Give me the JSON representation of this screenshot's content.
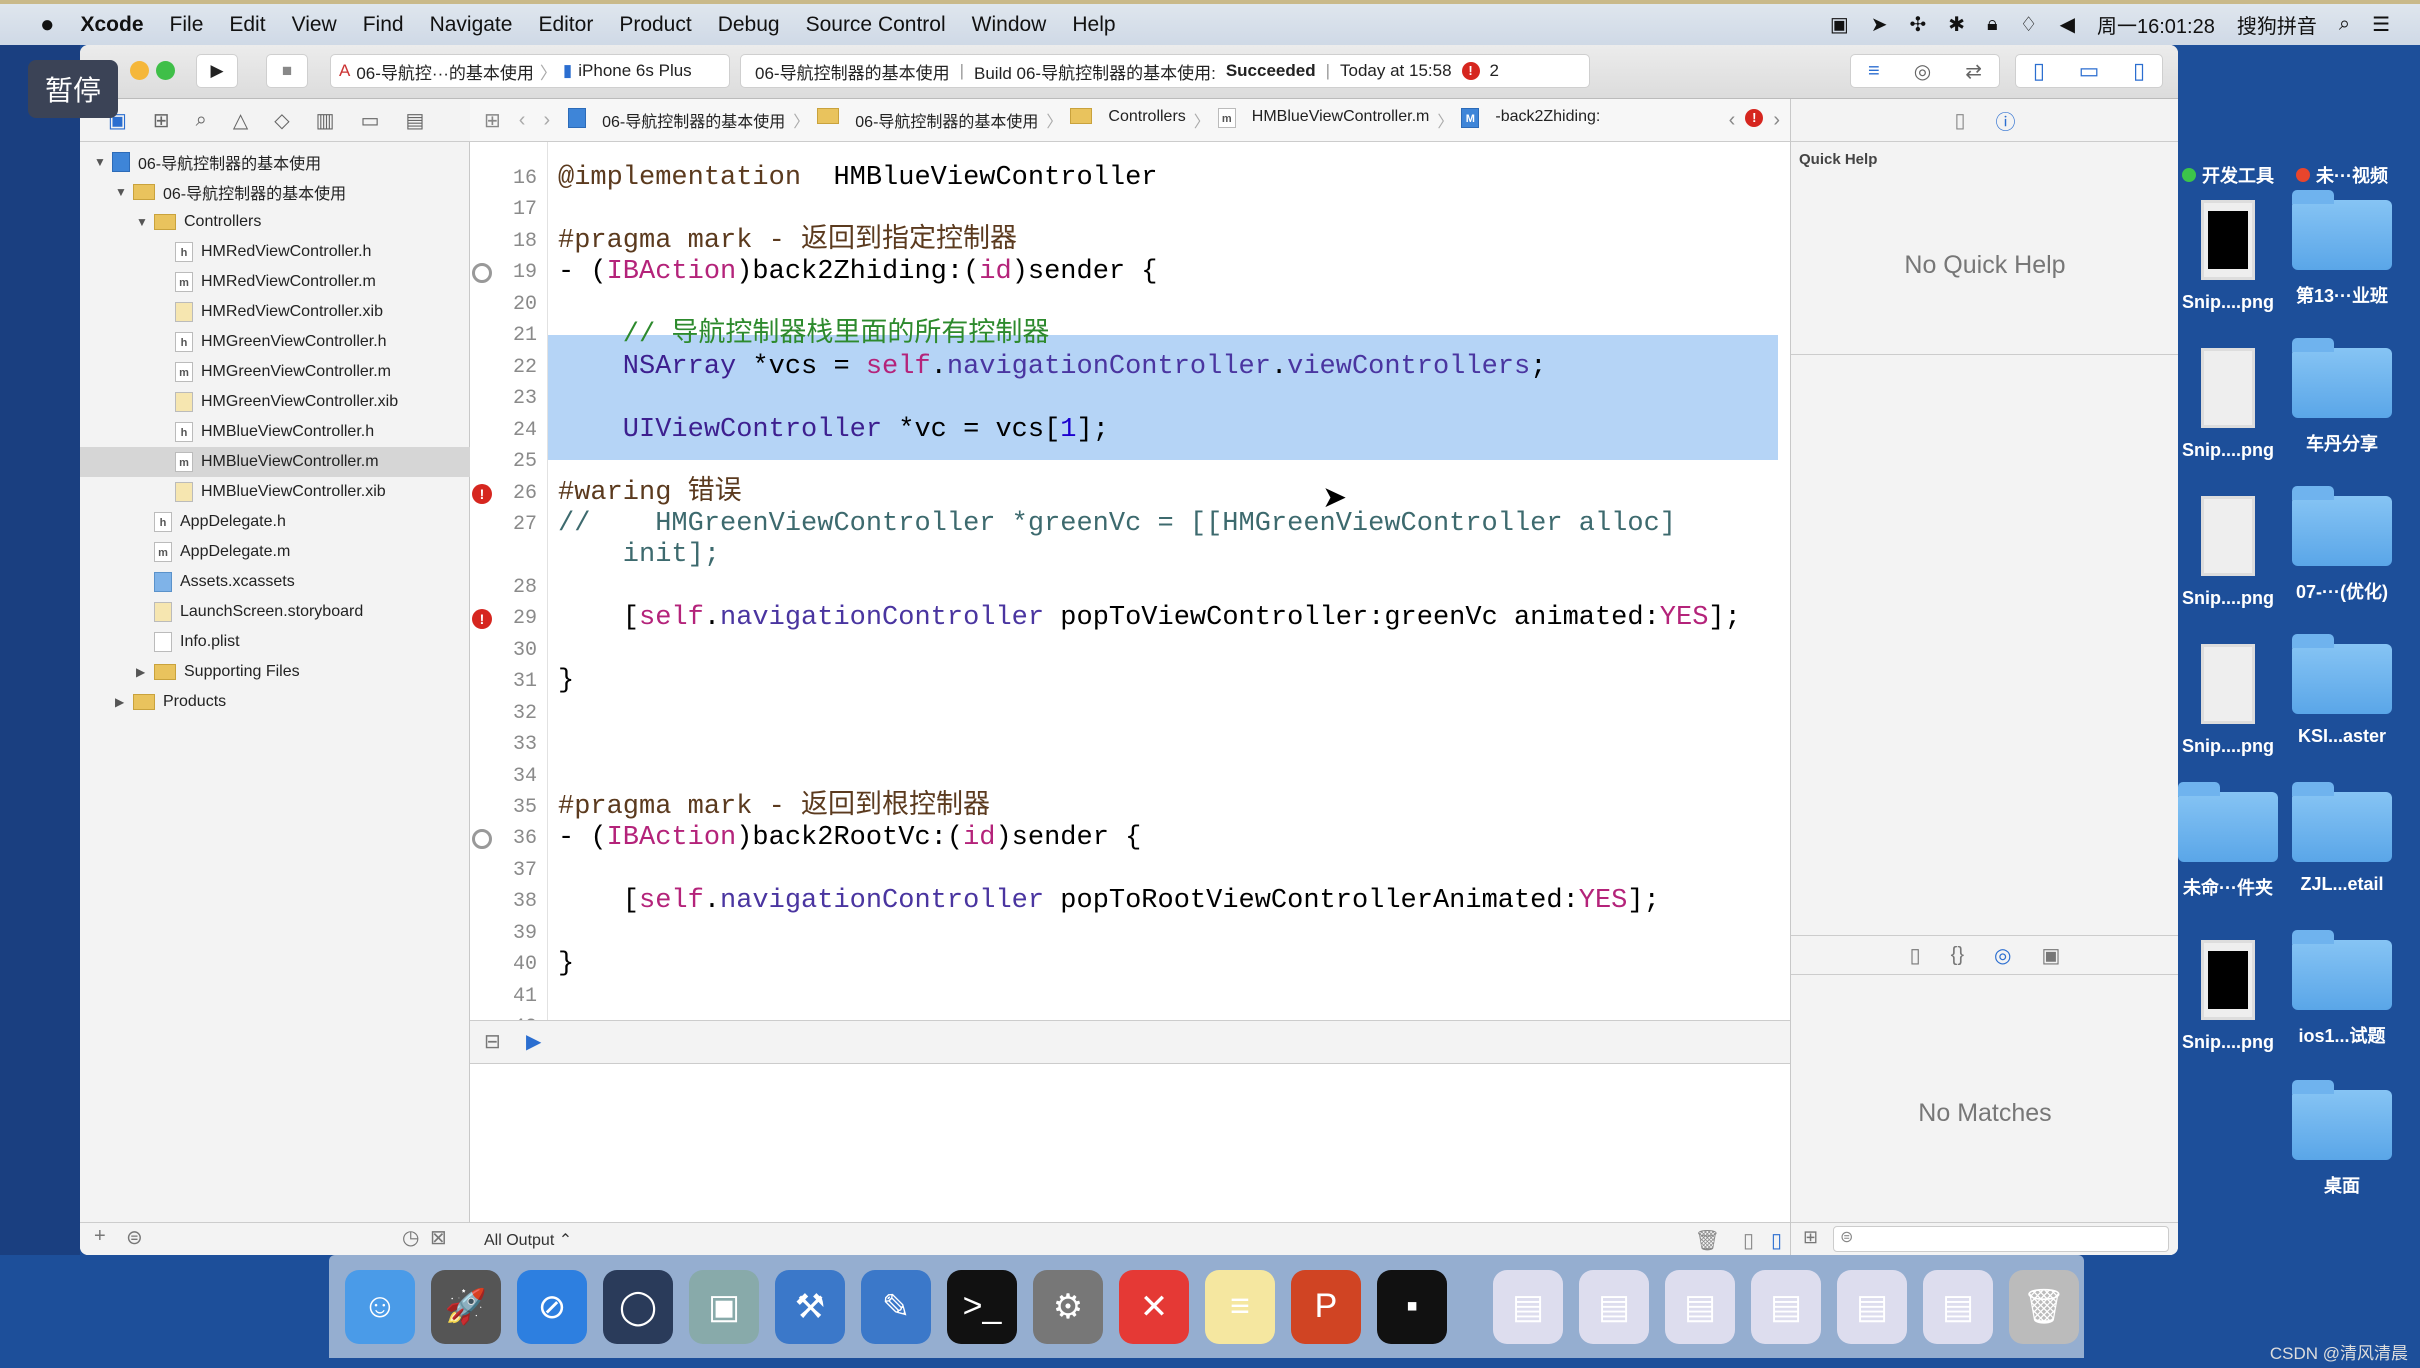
{
  "menubar": {
    "apple": "",
    "items": [
      "Xcode",
      "File",
      "Edit",
      "View",
      "Find",
      "Navigate",
      "Editor",
      "Product",
      "Debug",
      "Source Control",
      "Window",
      "Help"
    ],
    "clock": "周一16:01:28",
    "ime": "搜狗拼音"
  },
  "overlay": {
    "pause": "暂停"
  },
  "toolbar": {
    "scheme": "06-导航控···的基本使用",
    "device": "iPhone 6s Plus",
    "status_project": "06-导航控制器的基本使用",
    "status_build": "Build 06-导航控制器的基本使用:",
    "status_result": "Succeeded",
    "status_time": "Today at 15:58",
    "error_count": "2"
  },
  "navigator": {
    "rows": [
      {
        "label": "06-导航控制器的基本使用",
        "icon": "proj",
        "depth": 0,
        "tri": "▼"
      },
      {
        "label": "06-导航控制器的基本使用",
        "icon": "folder",
        "depth": 1,
        "tri": "▼"
      },
      {
        "label": "Controllers",
        "icon": "folder",
        "depth": 2,
        "tri": "▼"
      },
      {
        "label": "HMRedViewController.h",
        "icon": "h",
        "depth": 3
      },
      {
        "label": "HMRedViewController.m",
        "icon": "m",
        "depth": 3
      },
      {
        "label": "HMRedViewController.xib",
        "icon": "xib",
        "depth": 3
      },
      {
        "label": "HMGreenViewController.h",
        "icon": "h",
        "depth": 3
      },
      {
        "label": "HMGreenViewController.m",
        "icon": "m",
        "depth": 3
      },
      {
        "label": "HMGreenViewController.xib",
        "icon": "xib",
        "depth": 3
      },
      {
        "label": "HMBlueViewController.h",
        "icon": "h",
        "depth": 3
      },
      {
        "label": "HMBlueViewController.m",
        "icon": "m",
        "depth": 3,
        "selected": true
      },
      {
        "label": "HMBlueViewController.xib",
        "icon": "xib",
        "depth": 3
      },
      {
        "label": "AppDelegate.h",
        "icon": "h",
        "depth": 2
      },
      {
        "label": "AppDelegate.m",
        "icon": "m",
        "depth": 2
      },
      {
        "label": "Assets.xcassets",
        "icon": "assets",
        "depth": 2
      },
      {
        "label": "LaunchScreen.storyboard",
        "icon": "xib",
        "depth": 2
      },
      {
        "label": "Info.plist",
        "icon": "plist",
        "depth": 2
      },
      {
        "label": "Supporting Files",
        "icon": "folder",
        "depth": 2,
        "tri": "▶"
      },
      {
        "label": "Products",
        "icon": "folder",
        "depth": 1,
        "tri": "▶"
      }
    ]
  },
  "jumpbar": [
    "06-导航控制器的基本使用",
    "06-导航控制器的基本使用",
    "Controllers",
    "HMBlueViewController.m",
    "-back2Zhiding:"
  ],
  "editor": {
    "lines": [
      {
        "n": "16",
        "toks": [
          [
            "pr",
            "@implementation"
          ],
          [
            "",
            "  HMBlueViewController"
          ]
        ]
      },
      {
        "n": "17",
        "toks": []
      },
      {
        "n": "18",
        "toks": [
          [
            "pr",
            "#pragma mark - 返回到指定控制器"
          ]
        ]
      },
      {
        "n": "19",
        "marker": "bp",
        "toks": [
          [
            "",
            "- ("
          ],
          [
            "kw",
            "IBAction"
          ],
          [
            "",
            ")back2Zhiding:("
          ],
          [
            "kw",
            "id"
          ],
          [
            "",
            ")sender {"
          ]
        ]
      },
      {
        "n": "20",
        "toks": []
      },
      {
        "n": "21",
        "toks": [
          [
            "cm",
            "    // 导航控制器栈里面的所有控制器"
          ]
        ]
      },
      {
        "n": "22",
        "toks": [
          [
            "cls",
            "    NSArray"
          ],
          [
            "",
            " *vcs = "
          ],
          [
            "kw",
            "self"
          ],
          [
            "",
            "."
          ],
          [
            "me",
            "navigationController"
          ],
          [
            "",
            "."
          ],
          [
            "me",
            "viewControllers"
          ],
          [
            "",
            ";"
          ]
        ]
      },
      {
        "n": "23",
        "toks": []
      },
      {
        "n": "24",
        "toks": [
          [
            "cls",
            "    UIViewController"
          ],
          [
            "",
            " *vc = vcs["
          ],
          [
            "nm",
            "1"
          ],
          [
            "",
            "];"
          ]
        ]
      },
      {
        "n": "25",
        "toks": []
      },
      {
        "n": "26",
        "marker": "err",
        "toks": [
          [
            "pr",
            "#waring 错误"
          ]
        ]
      },
      {
        "n": "27",
        "toks": [
          [
            "cmt2",
            "//    HMGreenViewController *greenVc = [[HMGreenViewController alloc]"
          ]
        ]
      },
      {
        "n": "",
        "toks": [
          [
            "cmt2",
            "    init];"
          ]
        ]
      },
      {
        "n": "28",
        "toks": []
      },
      {
        "n": "29",
        "marker": "err",
        "toks": [
          [
            "",
            "    ["
          ],
          [
            "kw",
            "self"
          ],
          [
            "",
            "."
          ],
          [
            "me",
            "navigationController"
          ],
          [
            "",
            " popToViewController:greenVc animated:"
          ],
          [
            "kw",
            "YES"
          ],
          [
            "",
            "];"
          ]
        ]
      },
      {
        "n": "30",
        "toks": []
      },
      {
        "n": "31",
        "toks": [
          [
            "",
            "}"
          ]
        ]
      },
      {
        "n": "32",
        "toks": []
      },
      {
        "n": "33",
        "toks": []
      },
      {
        "n": "34",
        "toks": []
      },
      {
        "n": "35",
        "toks": [
          [
            "pr",
            "#pragma mark - 返回到根控制器"
          ]
        ]
      },
      {
        "n": "36",
        "marker": "bp",
        "toks": [
          [
            "",
            "- ("
          ],
          [
            "kw",
            "IBAction"
          ],
          [
            "",
            ")back2RootVc:("
          ],
          [
            "kw",
            "id"
          ],
          [
            "",
            ")sender {"
          ]
        ]
      },
      {
        "n": "37",
        "toks": []
      },
      {
        "n": "38",
        "toks": [
          [
            "",
            "    ["
          ],
          [
            "kw",
            "self"
          ],
          [
            "",
            "."
          ],
          [
            "me",
            "navigationController"
          ],
          [
            "",
            " popToRootViewControllerAnimated:"
          ],
          [
            "kw",
            "YES"
          ],
          [
            "",
            "];"
          ]
        ]
      },
      {
        "n": "39",
        "toks": []
      },
      {
        "n": "40",
        "toks": [
          [
            "",
            "}"
          ]
        ]
      },
      {
        "n": "41",
        "toks": []
      },
      {
        "n": "42",
        "toks": []
      }
    ]
  },
  "console": {
    "filter": "All Output ⌃"
  },
  "inspector": {
    "title": "Quick Help",
    "quick_help": "No Quick Help",
    "library": "No Matches"
  },
  "desktop": {
    "items": [
      {
        "label": "开发工具",
        "type": "tag",
        "color": "#3cc44a"
      },
      {
        "label": "未···视频",
        "type": "tag",
        "color": "#e8452c"
      },
      {
        "label": "Snip....png",
        "type": "thumb-dark"
      },
      {
        "label": "第13···业班",
        "type": "folder"
      },
      {
        "label": "Snip....png",
        "type": "thumb"
      },
      {
        "label": "车丹分享",
        "type": "folder"
      },
      {
        "label": "Snip....png",
        "type": "thumb"
      },
      {
        "label": "07-···(优化)",
        "type": "folder"
      },
      {
        "label": "Snip....png",
        "type": "thumb"
      },
      {
        "label": "KSI...aster",
        "type": "folder"
      },
      {
        "label": "未命···件夹",
        "type": "folder"
      },
      {
        "label": "ZJL...etail",
        "type": "folder"
      },
      {
        "label": "Snip....png",
        "type": "thumb-dark"
      },
      {
        "label": "ios1...试题",
        "type": "folder"
      },
      {
        "label": "",
        "type": "none"
      },
      {
        "label": "桌面",
        "type": "folder"
      }
    ]
  },
  "dock": [
    {
      "name": "finder",
      "color": "#4a9be8",
      "glyph": "☺"
    },
    {
      "name": "launchpad",
      "color": "#555",
      "glyph": "🚀"
    },
    {
      "name": "safari",
      "color": "#2d7fe0",
      "glyph": "⊘"
    },
    {
      "name": "mouse",
      "color": "#2a3b5a",
      "glyph": "◯"
    },
    {
      "name": "photo-booth",
      "color": "#8aa",
      "glyph": "▣"
    },
    {
      "name": "xcode",
      "color": "#3b78c9",
      "glyph": "⚒"
    },
    {
      "name": "instruments",
      "color": "#3b78c9",
      "glyph": "✎"
    },
    {
      "name": "terminal",
      "color": "#111",
      "glyph": ">_"
    },
    {
      "name": "system-preferences",
      "color": "#777",
      "glyph": "⚙"
    },
    {
      "name": "xmind",
      "color": "#e53935",
      "glyph": "✕"
    },
    {
      "name": "notes",
      "color": "#f5e7a0",
      "glyph": "≡"
    },
    {
      "name": "powerpoint",
      "color": "#d04423",
      "glyph": "P"
    },
    {
      "name": "console",
      "color": "#111",
      "glyph": "▪"
    },
    {
      "name": "doc1",
      "color": "#dde",
      "glyph": "▤"
    },
    {
      "name": "doc2",
      "color": "#dde",
      "glyph": "▤"
    },
    {
      "name": "doc3",
      "color": "#dde",
      "glyph": "▤"
    },
    {
      "name": "doc4",
      "color": "#dde",
      "glyph": "▤"
    },
    {
      "name": "doc5",
      "color": "#dde",
      "glyph": "▤"
    },
    {
      "name": "doc6",
      "color": "#dde",
      "glyph": "▤"
    },
    {
      "name": "trash",
      "color": "#bbb",
      "glyph": "🗑"
    }
  ],
  "watermark": "CSDN @清风清晨"
}
